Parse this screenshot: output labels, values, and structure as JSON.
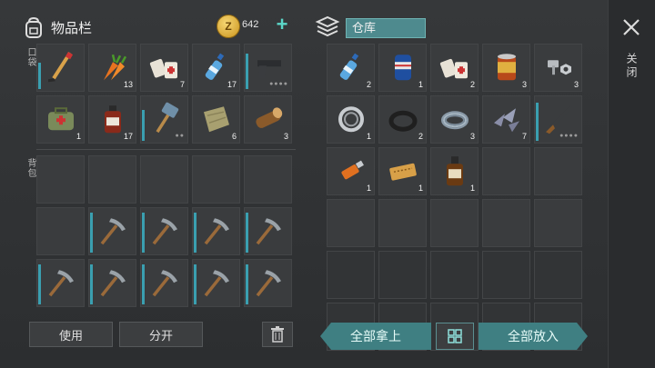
{
  "inventory": {
    "title": "物品栏",
    "coins": "642",
    "coin_glyph": "Z",
    "pocket_label": "口袋",
    "backpack_label": "背包",
    "pocket_slots": [
      {
        "icon": "hockey-stick-icon",
        "count": "",
        "bar": 0.6
      },
      {
        "icon": "carrot-icon",
        "count": "13"
      },
      {
        "icon": "bandage-icon",
        "count": "7"
      },
      {
        "icon": "water-bottle-icon",
        "count": "17"
      },
      {
        "icon": "pistol-icon",
        "count": "",
        "bar": 0.8,
        "dots": "●●●●"
      },
      {
        "icon": "medkit-bag-icon",
        "count": "1"
      },
      {
        "icon": "medicine-bottle-icon",
        "count": "17"
      },
      {
        "icon": "sledgehammer-icon",
        "count": "",
        "bar": 0.7,
        "dots": "●●"
      },
      {
        "icon": "cloth-icon",
        "count": "6"
      },
      {
        "icon": "log-icon",
        "count": "3"
      }
    ],
    "backpack_slots": [
      {
        "icon": ""
      },
      {
        "icon": ""
      },
      {
        "icon": ""
      },
      {
        "icon": ""
      },
      {
        "icon": ""
      },
      {
        "icon": ""
      },
      {
        "icon": "pickaxe-icon",
        "bar": 0.9
      },
      {
        "icon": "pickaxe-icon",
        "bar": 0.9
      },
      {
        "icon": "pickaxe-icon",
        "bar": 0.9
      },
      {
        "icon": "pickaxe-icon",
        "bar": 0.9
      },
      {
        "icon": "pickaxe-icon",
        "bar": 0.9
      },
      {
        "icon": "pickaxe-icon",
        "bar": 0.9
      },
      {
        "icon": "pickaxe-icon",
        "bar": 0.9
      },
      {
        "icon": "pickaxe-icon",
        "bar": 0.9
      },
      {
        "icon": "pickaxe-icon",
        "bar": 0.9
      }
    ],
    "use_label": "使用",
    "split_label": "分开"
  },
  "warehouse": {
    "title": "仓库",
    "slots": [
      {
        "icon": "water-bottle-icon",
        "count": "2"
      },
      {
        "icon": "soda-can-icon",
        "count": "1"
      },
      {
        "icon": "bandage-icon",
        "count": "2"
      },
      {
        "icon": "canned-food-icon",
        "count": "3"
      },
      {
        "icon": "bolt-nut-icon",
        "count": "3"
      },
      {
        "icon": "bearing-icon",
        "count": "1"
      },
      {
        "icon": "rubber-ring-icon",
        "count": "2"
      },
      {
        "icon": "wire-coil-icon",
        "count": "3"
      },
      {
        "icon": "scrap-metal-icon",
        "count": "7"
      },
      {
        "icon": "shotgun-icon",
        "count": "",
        "bar": 0.85,
        "dots": "●●●●"
      },
      {
        "icon": "usb-drive-icon",
        "count": "1"
      },
      {
        "icon": "ticket-icon",
        "count": "1"
      },
      {
        "icon": "whiskey-bottle-icon",
        "count": "1"
      },
      {
        "icon": ""
      },
      {
        "icon": ""
      },
      {
        "icon": ""
      },
      {
        "icon": ""
      },
      {
        "icon": ""
      },
      {
        "icon": ""
      },
      {
        "icon": ""
      },
      {
        "icon": ""
      },
      {
        "icon": ""
      },
      {
        "icon": ""
      },
      {
        "icon": ""
      },
      {
        "icon": ""
      },
      {
        "icon": ""
      },
      {
        "icon": ""
      },
      {
        "icon": ""
      },
      {
        "icon": ""
      },
      {
        "icon": ""
      }
    ],
    "take_all_label": "全部拿上",
    "put_all_label": "全部放入"
  },
  "close_label": "关闭",
  "colors": {
    "accent": "#3f7f82",
    "durability": "#3a9fb0",
    "coin": "#e0ad3a"
  }
}
